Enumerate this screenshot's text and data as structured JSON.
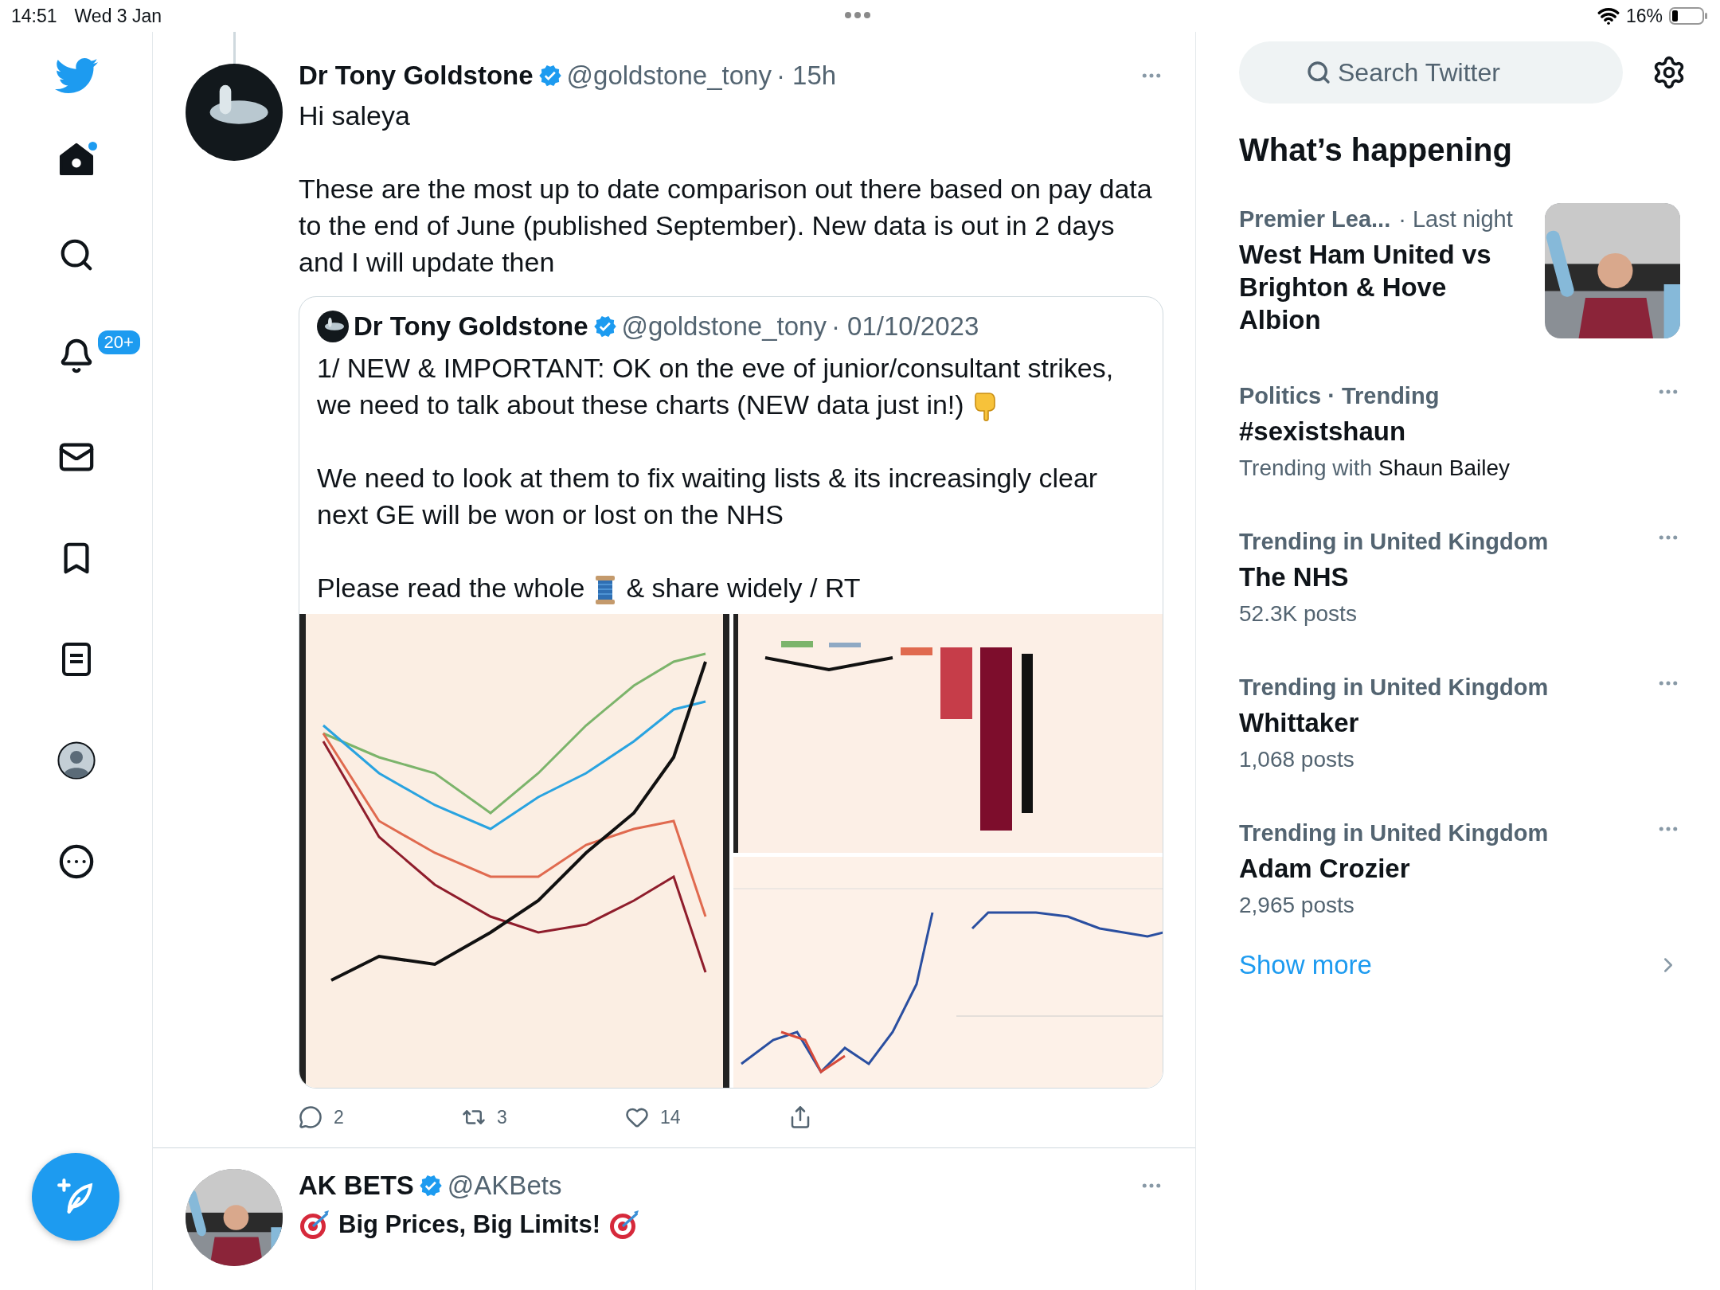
{
  "status_bar": {
    "time": "14:51",
    "date": "Wed 3 Jan",
    "battery": "16%"
  },
  "sidebar": {
    "items": [
      {
        "kind": "home",
        "selected": true,
        "unread": true
      },
      {
        "kind": "explore",
        "selected": false
      },
      {
        "kind": "notifications",
        "selected": false,
        "badge": "20+"
      },
      {
        "kind": "messages",
        "selected": false
      },
      {
        "kind": "bookmarks",
        "selected": false
      },
      {
        "kind": "lists",
        "selected": false
      },
      {
        "kind": "profile",
        "selected": false
      },
      {
        "kind": "more",
        "selected": false
      }
    ]
  },
  "tweets": [
    {
      "name": "Dr Tony Goldstone",
      "verified": true,
      "handle": "@goldstone_tony",
      "time": "· 15h",
      "paragraphs": [
        "Hi saleya",
        "These are the most up to date comparison out there based on pay data to the end of June (published September). New data is out in 2 days and I will update then"
      ],
      "quote": {
        "name": "Dr Tony Goldstone",
        "verified": true,
        "handle": "@goldstone_tony",
        "time": "· 01/10/2023",
        "paragraphs": [
          [
            [
              {
                "kind": "text",
                "text": "1/ NEW & IMPORTANT: OK on the eve of junior/consultant strikes,"
              }
            ],
            [
              {
                "kind": "text",
                "text": "we need to talk about these charts (NEW data just in!)"
              },
              {
                "kind": "hand"
              }
            ]
          ],
          [
            [
              {
                "kind": "text",
                "text": "We need to look at them to fix waiting lists & its increasingly clear next GE will be won or lost on the NHS"
              }
            ]
          ],
          [
            [
              {
                "kind": "text",
                "text": "Please read the whole"
              },
              {
                "kind": "spool"
              },
              {
                "kind": "text",
                "text": "& share widely / RT"
              }
            ]
          ]
        ],
        "media": [
          {
            "kind": "picture"
          },
          {
            "kind": "picture"
          },
          {
            "kind": "picture"
          }
        ]
      },
      "actions": [
        {
          "kind": "reply",
          "count": "2"
        },
        {
          "kind": "retweet",
          "count": "3"
        },
        {
          "kind": "like",
          "count": "14"
        },
        {
          "kind": "share"
        }
      ]
    },
    {
      "name": "AK BETS",
      "verified": true,
      "handle": "@AKBets",
      "headline": "Big Prices, Big Limits!"
    }
  ],
  "right": {
    "search": {
      "placeholder": "Search Twitter"
    },
    "heading": "What’s happening",
    "trends": [
      {
        "context": "Premier Lea...",
        "meta": "· Last night",
        "title": "West Ham United vs Brighton & Hove Albion",
        "has_image": true
      },
      {
        "context": "Politics · Trending",
        "title": "#sexistshaun",
        "subtitle": "Trending with",
        "subtitle_name": "Shaun Bailey",
        "more": true
      },
      {
        "context": "Trending in United Kingdom",
        "title": "The NHS",
        "subtitle": "52.3K posts",
        "more": true
      },
      {
        "context": "Trending in United Kingdom",
        "title": "Whittaker",
        "subtitle": "1,068 posts",
        "more": true
      },
      {
        "context": "Trending in United Kingdom",
        "title": "Adam Crozier",
        "subtitle": "2,965 posts",
        "more": true
      }
    ],
    "show_more": "Show more"
  }
}
